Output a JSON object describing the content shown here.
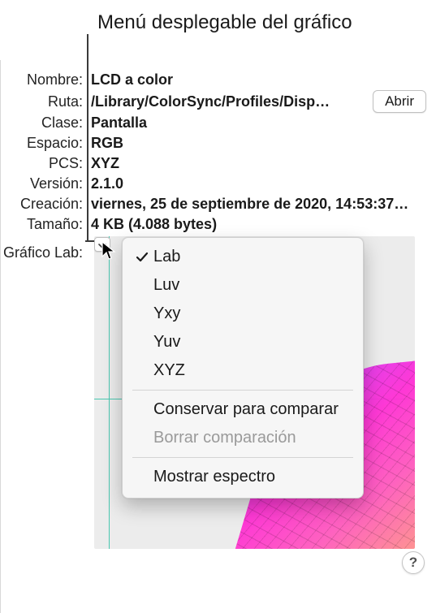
{
  "caption": "Menú desplegable del gráfico",
  "labels": {
    "nombre": "Nombre:",
    "ruta": "Ruta:",
    "clase": "Clase:",
    "espacio": "Espacio:",
    "pcs": "PCS:",
    "version": "Versión:",
    "creacion": "Creación:",
    "tamano": "Tamaño:",
    "grafico": "Gráfico Lab:"
  },
  "values": {
    "nombre": "LCD a color",
    "ruta": "/Library/ColorSync/Profiles/Disp…",
    "clase": "Pantalla",
    "espacio": "RGB",
    "pcs": "XYZ",
    "version": "2.1.0",
    "creacion": "viernes, 25 de septiembre de 2020, 14:53:37…",
    "tamano": "4 KB (4.088 bytes)"
  },
  "buttons": {
    "abrir": "Abrir",
    "help": "?"
  },
  "menu": {
    "items": [
      {
        "label": "Lab",
        "checked": true,
        "enabled": true
      },
      {
        "label": "Luv",
        "checked": false,
        "enabled": true
      },
      {
        "label": "Yxy",
        "checked": false,
        "enabled": true
      },
      {
        "label": "Yuv",
        "checked": false,
        "enabled": true
      },
      {
        "label": "XYZ",
        "checked": false,
        "enabled": true
      }
    ],
    "conservar": "Conservar para comparar",
    "borrar": "Borrar comparación",
    "mostrar": "Mostrar espectro"
  }
}
